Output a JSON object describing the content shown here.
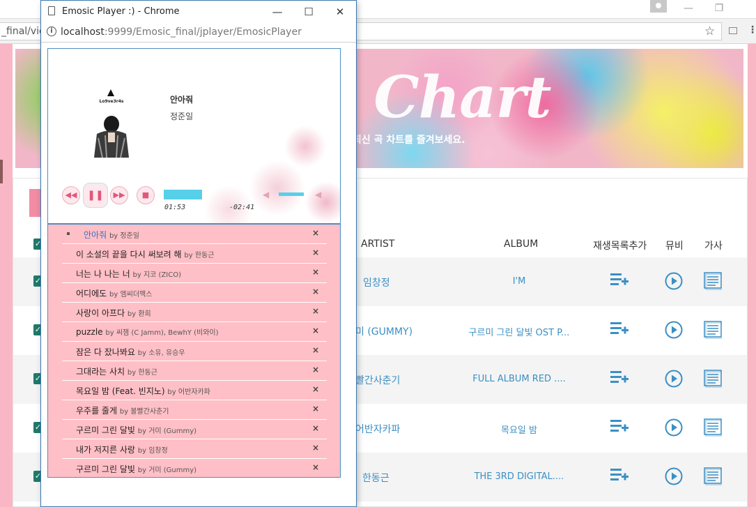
{
  "main_browser": {
    "url_partial": "_final/view",
    "minimize": "—",
    "restore": "❐",
    "star": "☆",
    "menu": "⋮"
  },
  "banner": {
    "title": "t Chart",
    "subtitle": "최신 곡 차트를 즐겨보세요."
  },
  "chart_table": {
    "headers": {
      "artist": "ARTIST",
      "album": "ALBUM",
      "add_playlist": "재생목록추가",
      "mv": "뮤비",
      "lyrics": "가사"
    },
    "rows": [
      {
        "artist": "임창정",
        "album": "I'M"
      },
      {
        "artist": "미 (GUMMY)",
        "album": "구르미 그린 달빛 OST P..."
      },
      {
        "artist": "빨간사춘기",
        "album": "FULL ALBUM RED ...."
      },
      {
        "artist": "어반자카파",
        "album": "목요일 밤"
      },
      {
        "artist": "한동근",
        "album": "THE 3RD DIGITAL...."
      }
    ]
  },
  "popup": {
    "title": "Emosic Player :) - Chrome",
    "minimize": "—",
    "maximize": "☐",
    "close": "✕",
    "url_host": "localhost",
    "url_rest": ":9999/Emosic_final/jplayer/EmosicPlayer",
    "info_glyph": "i"
  },
  "player": {
    "cover_label": "Lo9ve3r4s",
    "song_title": "안아줘",
    "song_artist": "정준일",
    "controls": {
      "prev": "◀◀",
      "play_pause": "❚❚",
      "next": "▶▶",
      "stop": "■"
    },
    "time_current": "01:53",
    "time_remaining": "-02:41",
    "progress": 0.41,
    "volume": 0.8,
    "vol_mute_glyph": "◀",
    "vol_max_glyph": "◀"
  },
  "playlist": {
    "remove_glyph": "×",
    "items": [
      {
        "title": "안아줘",
        "artist": "by 정준일",
        "current": true
      },
      {
        "title": "이 소설의 끝을 다시 써보려 해",
        "artist": "by 한동근",
        "current": false
      },
      {
        "title": "너는 나 나는 너",
        "artist": "by 지코 (ZICO)",
        "current": false
      },
      {
        "title": "어디에도",
        "artist": "by 엠씨더맥스",
        "current": false
      },
      {
        "title": "사랑이 아프다",
        "artist": "by 환희",
        "current": false
      },
      {
        "title": "puzzle",
        "artist": "by 씨잼 (C Jamm), BewhY (비와이)",
        "current": false
      },
      {
        "title": "잠은 다 잤나봐요",
        "artist": "by 소유, 유승우",
        "current": false
      },
      {
        "title": "그대라는 사치",
        "artist": "by 한동근",
        "current": false
      },
      {
        "title": "목요일 밤 (Feat. 빈지노)",
        "artist": "by 어반자카파",
        "current": false
      },
      {
        "title": "우주를 줄게",
        "artist": "by 볼빨간사춘기",
        "current": false
      },
      {
        "title": "구르미 그린 달빛",
        "artist": "by 거미 (Gummy)",
        "current": false
      },
      {
        "title": "내가 저지른 사랑",
        "artist": "by 임창정",
        "current": false
      },
      {
        "title": "구르미 그린 달빛",
        "artist": "by 거미 (Gummy)",
        "current": false
      }
    ]
  }
}
